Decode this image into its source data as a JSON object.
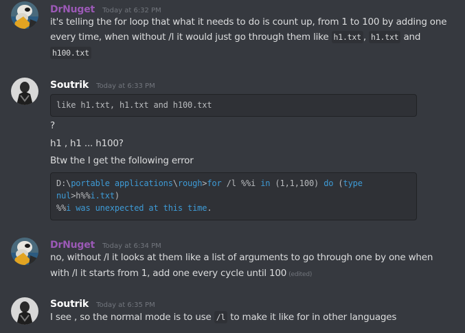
{
  "colors": {
    "background": "#36393f",
    "drnuget_name": "#9b59b6",
    "soutrik_name": "#ffffff",
    "text": "#dcddde",
    "timestamp": "#72767d",
    "code_bg": "#2f3136",
    "code_keyword": "#3e9bd6"
  },
  "messages": [
    {
      "author": "DrNuget",
      "timestamp": "Today at 6:32 PM",
      "line1": "it's telling the for loop that what it needs to do is count up, from 1 to 100 by adding one",
      "line2_a": "every time, when without /l it would just go through them like ",
      "code_a": "h1.txt",
      "sep": ", ",
      "code_b": "h1.txt",
      "and": " and",
      "code_c": "h100.txt"
    },
    {
      "author": "Soutrik",
      "timestamp": "Today at 6:33 PM",
      "code_block": "like h1.txt, h1.txt and h100.txt",
      "q": "?",
      "line_h1": "h1 , h1 ... h100?",
      "line_err": "Btw the I get the following error",
      "err": {
        "l1_a": "D:\\",
        "l1_b": "portable applications",
        "l1_c": "\\",
        "l1_d": "rough",
        "l1_e": ">",
        "l1_f": "for",
        "l1_g": " /l ",
        "l1_h": "%%i ",
        "l1_i": "in",
        "l1_j": " (1,1,100) ",
        "l1_k": "do",
        "l1_l": " (",
        "l1_m": "type",
        "l2_a": "nul",
        "l2_b": ">h",
        "l2_c": "%%",
        "l2_d": "i.txt",
        "l2_e": ")",
        "l3_a": "%%",
        "l3_b": "i was unexpected at this time",
        "l3_c": "."
      }
    },
    {
      "author": "DrNuget",
      "timestamp": "Today at 6:34 PM",
      "line1": "no, without /l it looks at them like a list of arguments to go through one by one when",
      "line2": "with /l it starts from 1, add one every cycle until 100",
      "edited": "(edited)"
    },
    {
      "author": "Soutrik",
      "timestamp": "Today at 6:35 PM",
      "line_a": "I see , so the normal mode is to use ",
      "code": "/l",
      "line_b": " to make it like for in other languages"
    }
  ]
}
